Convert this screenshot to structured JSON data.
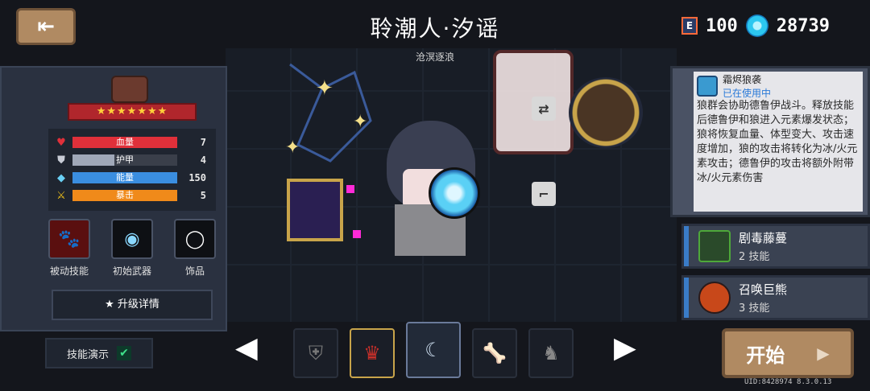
{
  "header": {
    "back_icon": "exit-door-icon",
    "title": "聆潮人·汐谣",
    "subtitle": "沧溟逐浪",
    "energy_badge": "E",
    "energy_value": "100",
    "gems_value": "28739"
  },
  "stats": [
    {
      "label": "血量",
      "value": "7",
      "icon": "heart-icon",
      "color": "#e0303a",
      "fill": 1.0
    },
    {
      "label": "护甲",
      "value": "4",
      "icon": "shield-icon",
      "color": "#a0a8b8",
      "fill": 0.4
    },
    {
      "label": "能量",
      "value": "150",
      "icon": "crystal-icon",
      "color": "#3a8ee0",
      "fill": 1.0
    },
    {
      "label": "暴击",
      "value": "5",
      "icon": "crit-icon",
      "color": "#f08a1a",
      "fill": 1.0
    }
  ],
  "rating_stars": "★★★★★★★",
  "slots": [
    {
      "label": "被动技能",
      "icon": "paw-icon"
    },
    {
      "label": "初始武器",
      "icon": "orb-weapon-icon"
    },
    {
      "label": "饰品",
      "icon": "ring-icon"
    }
  ],
  "upgrade_label": "★ 升级详情",
  "demo_label": "技能演示",
  "current_skill": {
    "name": "霜烬狼袭",
    "status": "已在使用中",
    "description": "狼群会协助德鲁伊战斗。释放技能后德鲁伊和狼进入元素爆发状态；狼将恢复血量、体型变大、攻击速度增加，狼的攻击将转化为冰/火元素攻击；德鲁伊的攻击将额外附带冰/火元素伤害"
  },
  "other_skills": [
    {
      "name": "剧毒藤蔓",
      "sub": "2 技能",
      "icon_color": "#2a4a2a"
    },
    {
      "name": "召唤巨熊",
      "sub": "3 技能",
      "icon_color": "#c8481a"
    }
  ],
  "start_label": "开始",
  "uid": "UID:8428974 8.3.0.13"
}
